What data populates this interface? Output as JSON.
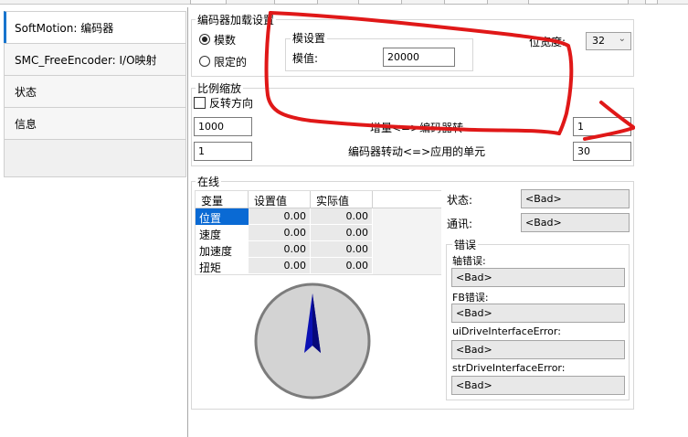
{
  "sidebar": {
    "tabs": [
      {
        "label": "SoftMotion: 编码器"
      },
      {
        "label": "SMC_FreeEncoder: I/O映射"
      },
      {
        "label": "状态"
      },
      {
        "label": "信息"
      }
    ]
  },
  "encoder_config": {
    "title": "编码器加载设置",
    "modulo_label": "模数",
    "limited_label": "限定的",
    "selected_mode": "模数",
    "modulo_settings": {
      "title": "模设置",
      "modulo_value_label": "模值:",
      "modulo_value": "20000"
    },
    "bit_width_label": "位宽度:",
    "bit_width_value": "32"
  },
  "scaling": {
    "title": "比例缩放",
    "invert_direction_label": "反转方向",
    "invert_direction_checked": false,
    "row1": {
      "left_value": "1000",
      "label": "增量<=>编码器转",
      "right_value": "1"
    },
    "row2": {
      "left_value": "1",
      "label": "编码器转动<=>应用的单元",
      "right_value": "30"
    }
  },
  "online": {
    "title": "在线",
    "table": {
      "headers": [
        "变量",
        "设置值",
        "实际值"
      ],
      "rows": [
        {
          "name": "位置",
          "set": "0.00",
          "actual": "0.00",
          "selected": true
        },
        {
          "name": "速度",
          "set": "0.00",
          "actual": "0.00",
          "selected": false
        },
        {
          "name": "加速度",
          "set": "0.00",
          "actual": "0.00",
          "selected": false
        },
        {
          "name": "扭矩",
          "set": "0.00",
          "actual": "0.00",
          "selected": false
        }
      ]
    },
    "status_label": "状态:",
    "status_value": "<Bad>",
    "comm_label": "通讯:",
    "comm_value": "<Bad>",
    "errors": {
      "title": "错误",
      "items": [
        {
          "label": "轴错误:",
          "value": "<Bad>"
        },
        {
          "label": "FB错误:",
          "value": "<Bad>"
        },
        {
          "label": "uiDriveInterfaceError:",
          "value": "<Bad>"
        },
        {
          "label": "strDriveInterfaceError:",
          "value": "<Bad>"
        }
      ]
    },
    "dial_angle_deg": 0
  },
  "colors": {
    "accent": "#1874cd",
    "selection": "#0a6ad4",
    "annotation_red": "#e01818",
    "needle_blue": "#0a10b4",
    "dial_fill": "#d3d3d3"
  }
}
